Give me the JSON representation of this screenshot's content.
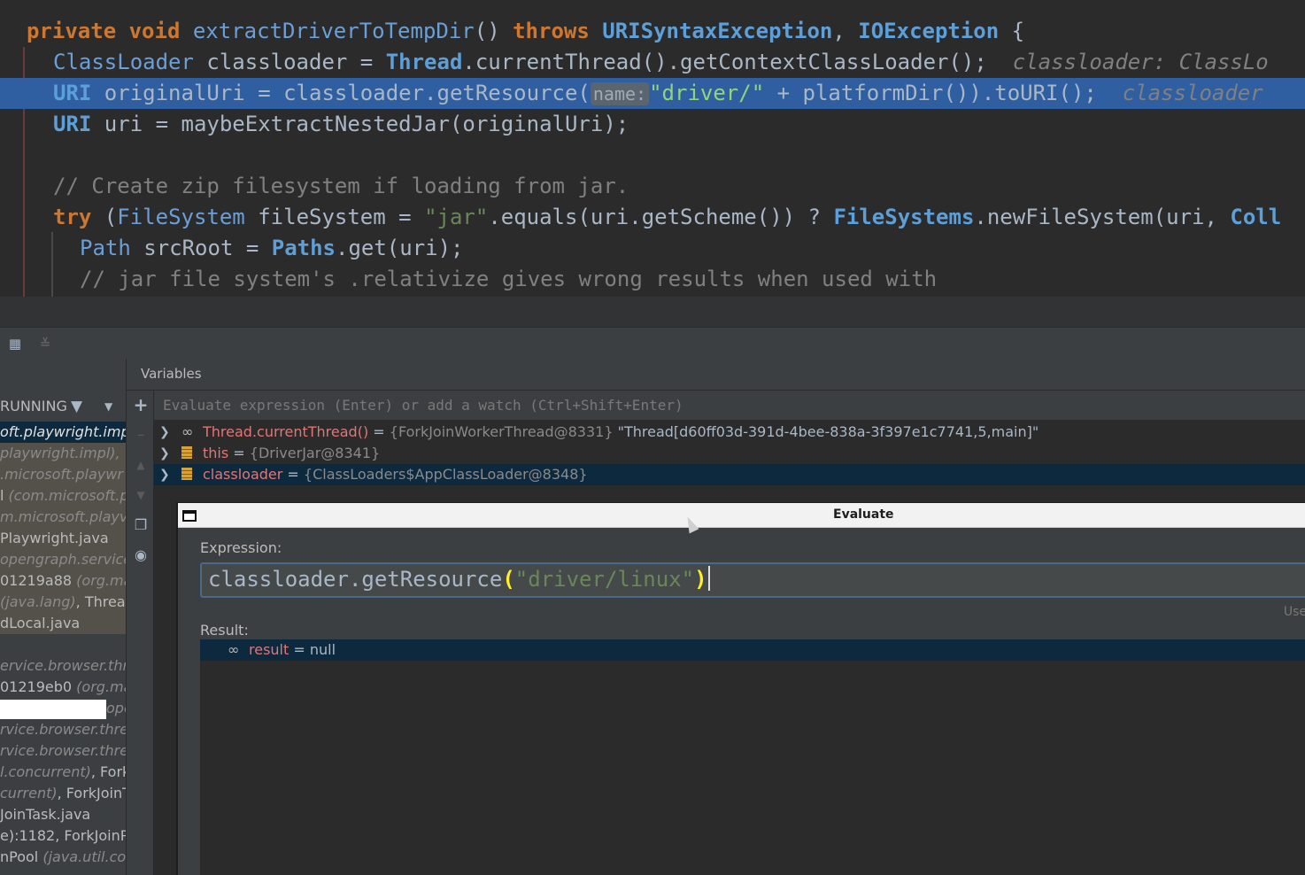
{
  "editor": {
    "line1": {
      "kw1": "private",
      "kw2": "void",
      "method": "extractDriverToTempDir",
      "paren": "() ",
      "kw3": "throws",
      "ex1": "URISyntaxException",
      "comma": ", ",
      "ex2": "IOException",
      "brace": " {"
    },
    "line2": {
      "type": "ClassLoader",
      "rest": " classloader = ",
      "thread": "Thread",
      "call": ".currentThread().getContextClassLoader();",
      "hint": "classloader: ClassLo"
    },
    "line3": {
      "type": "URI",
      "rest": " originalUri = classloader.getResource(",
      "param": "name:",
      "str": "\"driver/\"",
      "rest2": " + platformDir()).toURI();",
      "hint": "classloader"
    },
    "line4": {
      "type": "URI",
      "rest": " uri = maybeExtractNestedJar(originalUri);"
    },
    "line6": {
      "comment": "// Create zip filesystem if loading from jar."
    },
    "line7": {
      "kw": "try",
      "p1": " (",
      "type": "FileSystem",
      "rest": " fileSystem = ",
      "str": "\"jar\"",
      "rest2": ".equals(uri.getScheme()) ? ",
      "type2": "FileSystems",
      "rest3": ".newFileSystem(uri, ",
      "type3": "Coll"
    },
    "line8": {
      "type": "Path",
      "rest": " srcRoot = ",
      "type2": "Paths",
      "rest2": ".get(uri);"
    },
    "line9": {
      "comment": "// jar file system's .relativize gives wrong results when used with"
    }
  },
  "frames": {
    "header": "RUNNING",
    "items": [
      {
        "a": "oft.playwright.imp",
        "b": ""
      },
      {
        "a": "",
        "b": "playwright.impl),"
      },
      {
        "a": "",
        "b": ".microsoft.playwr"
      },
      {
        "a": "l ",
        "b": "(com.microsoft.p"
      },
      {
        "a": "",
        "b": "m.microsoft.playv"
      },
      {
        "a": " Playwright.java",
        "b": ""
      },
      {
        "a": "",
        "b": "opengraph.service"
      },
      {
        "a": "01219a88 ",
        "b": "(org.ma"
      },
      {
        "a": " ",
        "b": "(java.lang)",
        "c": ", Threa"
      },
      {
        "a": "dLocal.java",
        "b": ""
      },
      {
        "a": "",
        "b": "ervice.browser.thr"
      },
      {
        "a": "01219eb0 ",
        "b": "(org.ma"
      },
      {
        "a": "",
        "b": "ope"
      },
      {
        "a": "",
        "b": "rvice.browser.thre"
      },
      {
        "a": "",
        "b": "rvice.browser.thre"
      },
      {
        "a": "",
        "b": "l.concurrent)",
        "c": ", Fork"
      },
      {
        "a": "",
        "b": "current)",
        "c": ", ForkJoinT"
      },
      {
        "a": "JoinTask.java",
        "b": ""
      },
      {
        "a": "e):1182, ForkJoinPo",
        "b": ""
      },
      {
        "a": "nPool ",
        "b": "(java.util.co"
      }
    ]
  },
  "variables": {
    "title": "Variables",
    "eval_placeholder": "Evaluate expression (Enter) or add a watch (Ctrl+Shift+Enter)",
    "rows": [
      {
        "name": "Thread.currentThread()",
        "eq": " = ",
        "type": "{ForkJoinWorkerThread@8331}",
        "value": " \"Thread[d60ff03d-391d-4bee-838a-3f397e1c7741,5,main]\""
      },
      {
        "name": "this",
        "eq": " = ",
        "type": "{DriverJar@8341}",
        "value": ""
      },
      {
        "name": "classloader",
        "eq": " = ",
        "type": "{ClassLoaders$AppClassLoader@8348}",
        "value": ""
      }
    ]
  },
  "evaluate": {
    "title": "Evaluate",
    "expression_label": "Expression:",
    "expr_pre": "classloader.getResource",
    "expr_open": "(",
    "expr_str": "\"driver/linux\"",
    "expr_close": ")",
    "use_hint": "Use",
    "result_label": "Result:",
    "result_name": "result",
    "result_eq": " = ",
    "result_value": "null"
  }
}
